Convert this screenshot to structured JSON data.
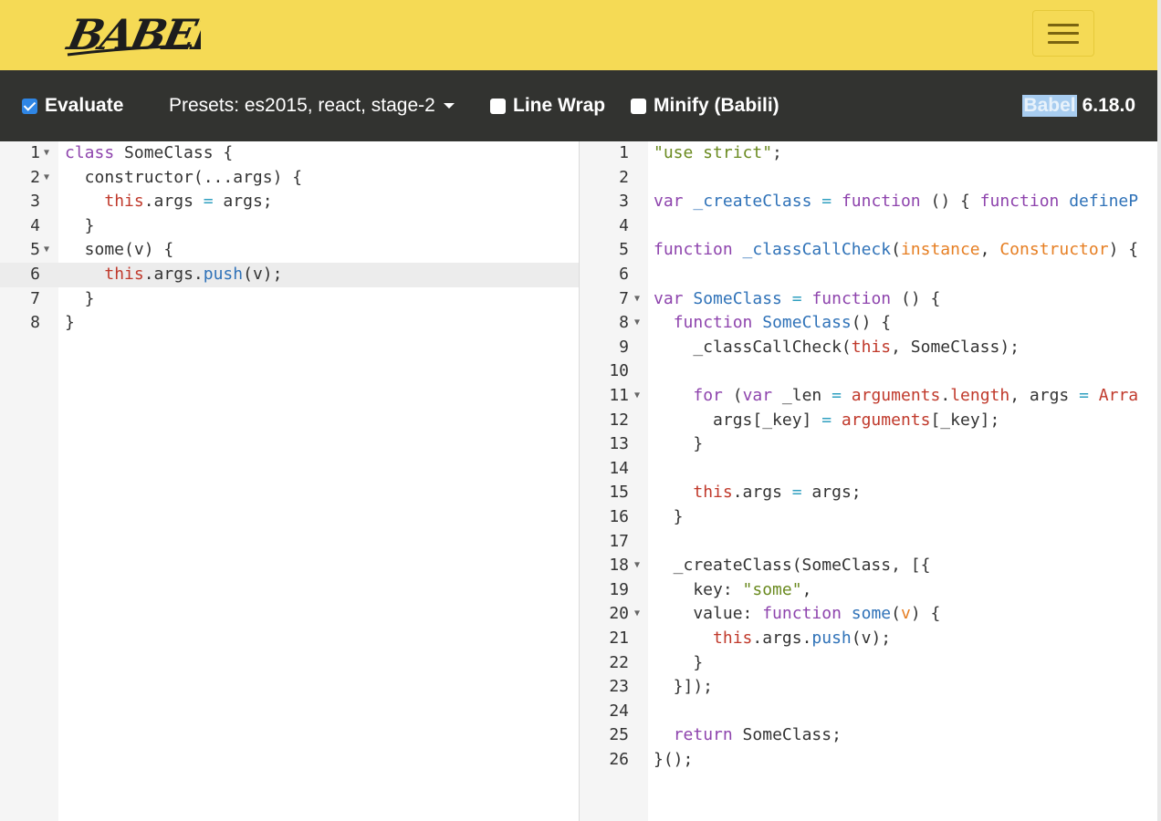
{
  "app": {
    "logo_text": "BABEL"
  },
  "toolbar": {
    "evaluate_label": "Evaluate",
    "presets_label": "Presets: es2015, react, stage-2",
    "linewrap_label": "Line Wrap",
    "minify_label": "Minify (Babili)",
    "version_prefix": "Babel",
    "version_number": "6.18.0",
    "evaluate_checked": true,
    "linewrap_checked": false,
    "minify_checked": false
  },
  "colors": {
    "topbar": "#f5da55",
    "optbar": "#323330",
    "accent": "#2f86e5"
  },
  "input": {
    "active_line": 6,
    "lines": [
      "class SomeClass {",
      "  constructor(...args) {",
      "    this.args = args;",
      "  }",
      "  some(v) {",
      "    this.args.push(v);",
      "  }",
      "}"
    ]
  },
  "output": {
    "lines": [
      "\"use strict\";",
      "",
      "var _createClass = function () { function defineP",
      "",
      "function _classCallCheck(instance, Constructor) {",
      "",
      "var SomeClass = function () {",
      "  function SomeClass() {",
      "    _classCallCheck(this, SomeClass);",
      "",
      "    for (var _len = arguments.length, args = Arra",
      "      args[_key] = arguments[_key];",
      "    }",
      "",
      "    this.args = args;",
      "  }",
      "",
      "  _createClass(SomeClass, [{",
      "    key: \"some\",",
      "    value: function some(v) {",
      "      this.args.push(v);",
      "    }",
      "  }]);",
      "",
      "  return SomeClass;",
      "}();"
    ]
  }
}
